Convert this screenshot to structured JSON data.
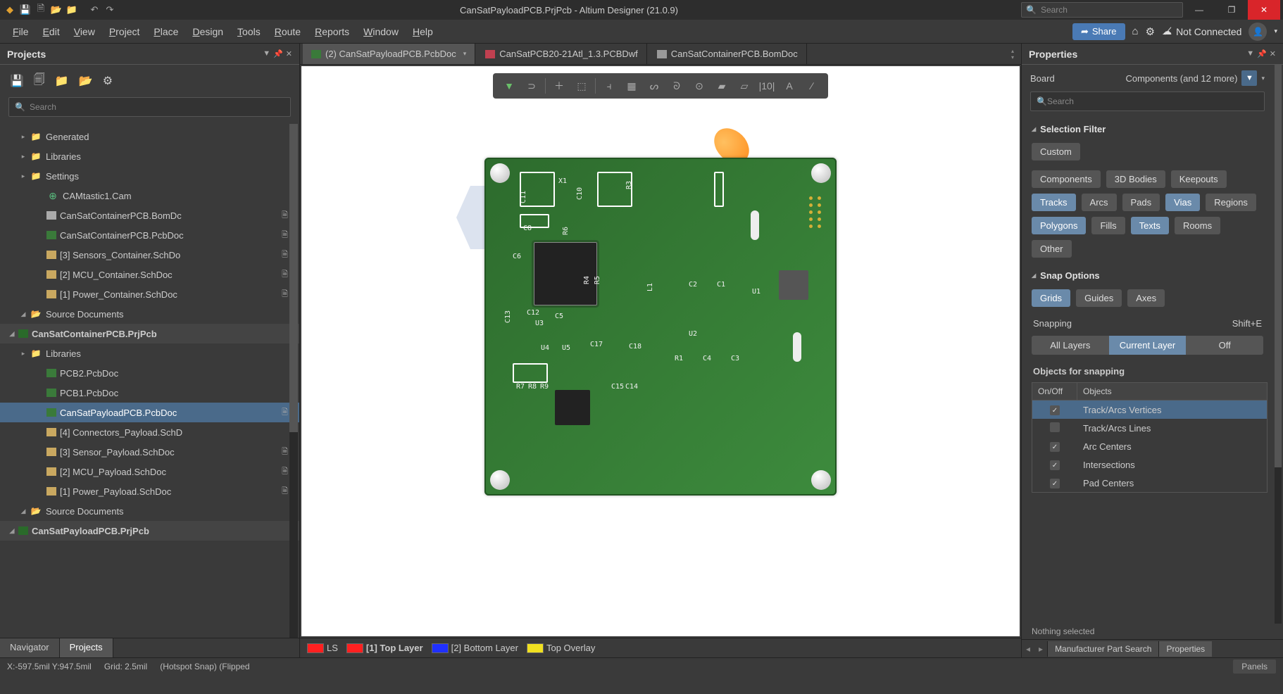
{
  "titlebar": {
    "title": "CanSatPayloadPCB.PrjPcb - Altium Designer (21.0.9)",
    "search_placeholder": "Search"
  },
  "menubar": {
    "items": [
      "File",
      "Edit",
      "View",
      "Project",
      "Place",
      "Design",
      "Tools",
      "Route",
      "Reports",
      "Window",
      "Help"
    ],
    "share": "Share",
    "not_connected": "Not Connected"
  },
  "projects_panel": {
    "title": "Projects",
    "search_placeholder": "Search",
    "tree": [
      {
        "type": "project",
        "label": "CanSatPayloadPCB.PrjPcb",
        "expanded": true
      },
      {
        "type": "folder",
        "label": "Source Documents",
        "indent": 1,
        "expanded": true
      },
      {
        "type": "schdoc",
        "label": "[1] Power_Payload.SchDoc",
        "indent": 2,
        "docico": true
      },
      {
        "type": "schdoc",
        "label": "[2] MCU_Payload.SchDoc",
        "indent": 2,
        "docico": true
      },
      {
        "type": "schdoc",
        "label": "[3] Sensor_Payload.SchDoc",
        "indent": 2,
        "docico": true
      },
      {
        "type": "schdoc",
        "label": "[4] Connectors_Payload.SchD",
        "indent": 2
      },
      {
        "type": "pcbdoc",
        "label": "CanSatPayloadPCB.PcbDoc",
        "indent": 2,
        "selected": true,
        "docico": true
      },
      {
        "type": "pcbdoc",
        "label": "PCB1.PcbDoc",
        "indent": 2
      },
      {
        "type": "pcbdoc",
        "label": "PCB2.PcbDoc",
        "indent": 2
      },
      {
        "type": "folder-closed",
        "label": "Libraries",
        "indent": 1
      },
      {
        "type": "project",
        "label": "CanSatContainerPCB.PrjPcb",
        "expanded": true
      },
      {
        "type": "folder",
        "label": "Source Documents",
        "indent": 1,
        "expanded": true
      },
      {
        "type": "schdoc",
        "label": "[1] Power_Container.SchDoc",
        "indent": 2,
        "docico": true
      },
      {
        "type": "schdoc",
        "label": "[2] MCU_Container.SchDoc",
        "indent": 2,
        "docico": true
      },
      {
        "type": "schdoc",
        "label": "[3] Sensors_Container.SchDo",
        "indent": 2,
        "docico": true
      },
      {
        "type": "pcbdoc",
        "label": "CanSatContainerPCB.PcbDoc",
        "indent": 2,
        "docico": true
      },
      {
        "type": "bom",
        "label": "CanSatContainerPCB.BomDc",
        "indent": 2,
        "docico": true
      },
      {
        "type": "cam",
        "label": "CAMtastic1.Cam",
        "indent": 2
      },
      {
        "type": "folder-closed",
        "label": "Settings",
        "indent": 1
      },
      {
        "type": "folder-closed",
        "label": "Libraries",
        "indent": 1
      },
      {
        "type": "folder-closed",
        "label": "Generated",
        "indent": 1
      }
    ]
  },
  "nav_tabs": [
    "Navigator",
    "Projects"
  ],
  "doc_tabs": [
    {
      "label": "(2) CanSatPayloadPCB.PcbDoc",
      "type": "pcb",
      "active": true,
      "dropdown": true
    },
    {
      "label": "CanSatPCB20-21Atl_1.3.PCBDwf",
      "type": "dwf"
    },
    {
      "label": "CanSatContainerPCB.BomDoc",
      "type": "bom"
    }
  ],
  "pcb_silk": [
    "C11",
    "X1",
    "C10",
    "R3",
    "C8",
    "R6",
    "C6",
    "U3",
    "R5",
    "R4",
    "L1",
    "C2",
    "C1",
    "U1",
    "C13",
    "C12",
    "C5",
    "U2",
    "U4",
    "U5",
    "C17",
    "C18",
    "R1",
    "C4",
    "C3",
    "R7",
    "R8",
    "R9",
    "C15",
    "C14"
  ],
  "editor_bottom": {
    "ls": "LS",
    "layers": [
      {
        "color": "#ff2020",
        "label": "[1] Top Layer",
        "bold": true
      },
      {
        "color": "#2030ff",
        "label": "[2] Bottom Layer"
      },
      {
        "color": "#f0e020",
        "label": "Top Overlay"
      }
    ]
  },
  "props_panel": {
    "title": "Properties",
    "board_label": "Board",
    "components_combo": "Components (and 12 more)",
    "search_placeholder": "Search",
    "selection_filter": {
      "title": "Selection Filter",
      "custom": "Custom",
      "chips": [
        {
          "label": "Components",
          "on": false
        },
        {
          "label": "3D Bodies",
          "on": false
        },
        {
          "label": "Keepouts",
          "on": false
        },
        {
          "label": "Tracks",
          "on": true
        },
        {
          "label": "Arcs",
          "on": false
        },
        {
          "label": "Pads",
          "on": false
        },
        {
          "label": "Vias",
          "on": true
        },
        {
          "label": "Regions",
          "on": false
        },
        {
          "label": "Polygons",
          "on": true
        },
        {
          "label": "Fills",
          "on": false
        },
        {
          "label": "Texts",
          "on": true
        },
        {
          "label": "Rooms",
          "on": false
        },
        {
          "label": "Other",
          "on": false
        }
      ]
    },
    "snap_options": {
      "title": "Snap Options",
      "chips": [
        {
          "label": "Grids",
          "on": true
        },
        {
          "label": "Guides",
          "on": false
        },
        {
          "label": "Axes",
          "on": false
        }
      ],
      "snapping_label": "Snapping",
      "snapping_shortcut": "Shift+E",
      "seg": [
        {
          "label": "All Layers",
          "on": false
        },
        {
          "label": "Current Layer",
          "on": true
        },
        {
          "label": "Off",
          "on": false
        }
      ],
      "objects_title": "Objects for snapping",
      "table_hdr": [
        "On/Off",
        "Objects"
      ],
      "rows": [
        {
          "on": true,
          "label": "Track/Arcs Vertices",
          "selected": true
        },
        {
          "on": false,
          "label": "Track/Arcs Lines"
        },
        {
          "on": true,
          "label": "Arc Centers"
        },
        {
          "on": true,
          "label": "Intersections"
        },
        {
          "on": true,
          "label": "Pad Centers"
        }
      ]
    },
    "nothing_selected": "Nothing selected",
    "bottom_tabs": [
      "Manufacturer Part Search",
      "Properties"
    ]
  },
  "statusbar": {
    "coords": "X:-597.5mil Y:947.5mil",
    "grid": "Grid: 2.5mil",
    "snap": "(Hotspot Snap) (Flipped",
    "panels": "Panels"
  }
}
